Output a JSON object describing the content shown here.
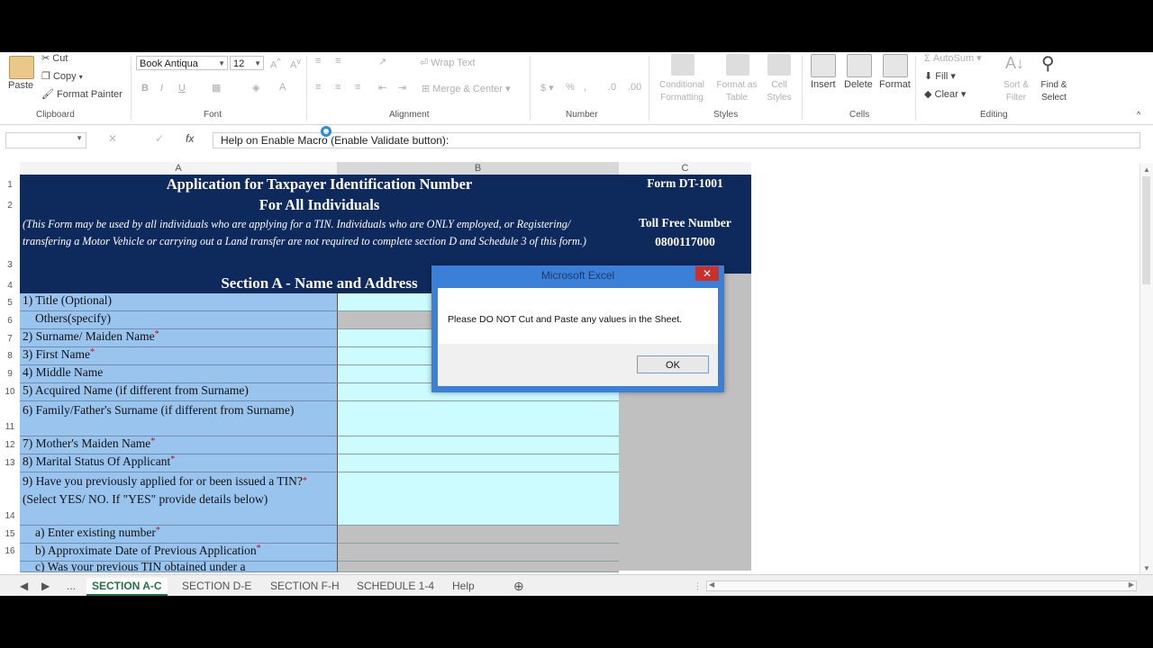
{
  "ribbon": {
    "clipboard": {
      "paste": "Paste",
      "cut": "Cut",
      "copy": "Copy",
      "format_painter": "Format Painter",
      "label": "Clipboard"
    },
    "font": {
      "name": "Book Antiqua",
      "size": "12",
      "label": "Font"
    },
    "alignment": {
      "wrap_text": "Wrap Text",
      "merge_center": "Merge & Center",
      "label": "Alignment"
    },
    "number": {
      "label": "Number"
    },
    "styles": {
      "conditional": "Conditional Formatting",
      "format_table": "Format as Table",
      "cell_styles": "Cell Styles",
      "label": "Styles"
    },
    "cells": {
      "insert": "Insert",
      "delete": "Delete",
      "format": "Format",
      "label": "Cells"
    },
    "editing": {
      "autosum": "AutoSum",
      "fill": "Fill",
      "clear": "Clear",
      "sort_filter": "Sort & Filter",
      "find_select": "Find & Select",
      "label": "Editing"
    }
  },
  "formula_bar": {
    "fx": "fx",
    "text": "Help on Enable Macro (Enable Validate button):"
  },
  "columns": [
    "A",
    "B",
    "C"
  ],
  "form": {
    "title": "Application for Taxpayer Identification Number",
    "subtitle": "For All Individuals",
    "form_no": "Form DT-1001",
    "toll_free_label": "Toll Free Number",
    "toll_free_number": "0800117000",
    "note": "(This Form may be used by all individuals who are applying for a TIN.  Individuals who are ONLY employed, or Registering/ transfering a Motor Vehicle or carrying out a Land transfer are not required to complete section D and Schedule 3 of this form.)",
    "section_a": "Section A - Name and Address",
    "rows": [
      {
        "num": "5",
        "label": "1) Title (Optional)",
        "req": false
      },
      {
        "num": "6",
        "label": "Others(specify)",
        "req": false
      },
      {
        "num": "7",
        "label": "2) Surname/ Maiden Name",
        "req": true
      },
      {
        "num": "8",
        "label": "3) First Name",
        "req": true
      },
      {
        "num": "9",
        "label": "4) Middle Name",
        "req": false
      },
      {
        "num": "10",
        "label": "5) Acquired Name (if different from Surname)",
        "req": false
      },
      {
        "num": "11",
        "label": "6) Family/Father's Surname (if different from Surname)",
        "req": false
      },
      {
        "num": "12",
        "label": "7) Mother's Maiden Name",
        "req": true
      },
      {
        "num": "13",
        "label": "8) Marital Status Of Applicant",
        "req": true
      },
      {
        "num": "14",
        "label": "9) Have you previously applied for or been issued a TIN?",
        "label2": " (Select YES/ NO. If \"YES\" provide details below)",
        "req": true
      },
      {
        "num": "15",
        "label": "a) Enter existing number",
        "req": true
      },
      {
        "num": "16",
        "label": "b) Approximate Date of Previous Application",
        "req": true
      },
      {
        "num": "",
        "label": "c) Was your previous TIN obtained under a",
        "req": false
      }
    ],
    "row_nums_top": [
      "1",
      "2",
      "3",
      "4"
    ]
  },
  "dialog": {
    "title": "Microsoft Excel",
    "close": "✕",
    "message": "Please DO NOT Cut and Paste any values in the Sheet.",
    "ok": "OK"
  },
  "tabs": [
    "SECTION A-C",
    "SECTION D-E",
    "SECTION F-H",
    "SCHEDULE 1-4",
    "Help"
  ],
  "tabs_more": "...",
  "tab_add": "⊕",
  "colors": {
    "navy": "#0e2a5c",
    "label_blue": "#99c4ee",
    "input_cyan": "#ccfcff",
    "excel_green": "#217346"
  }
}
